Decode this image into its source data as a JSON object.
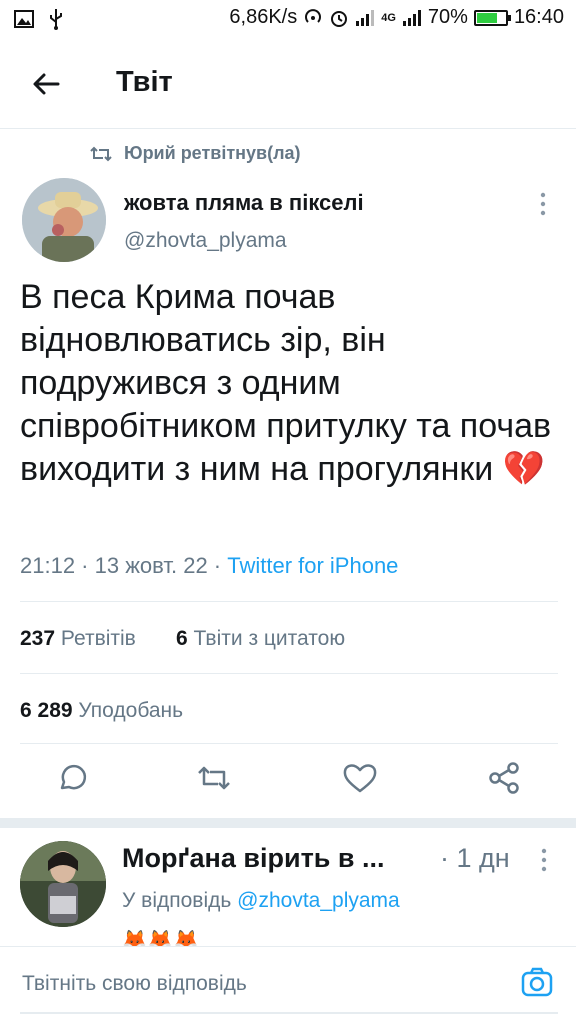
{
  "status_bar": {
    "speed": "6,86K/s",
    "net": "4G",
    "battery": "70%",
    "battery_level": 0.7,
    "time": "16:40",
    "icons": [
      "image-icon",
      "usb-icon",
      "hotspot-icon",
      "alarm-icon",
      "signal-icon",
      "signal-icon"
    ]
  },
  "header": {
    "title": "Твіт",
    "back_icon": "arrow-left-icon"
  },
  "tweet": {
    "retweeted_by": "Юрий ретвітнув(ла)",
    "author_name": "жовта пляма в пікселі",
    "author_handle": "@zhovta_plyama",
    "text": "В песа Крима почав відновлюватись зір, він подружився з одним співробітником притулку та почав виходити з ним на прогулянки 💔",
    "time": "21:12 · 13 жовт. 22 · ",
    "source": "Twitter for iPhone",
    "retweets_count": "237",
    "retweets_label": "Ретвітів",
    "quotes_count": "6",
    "quotes_label": "Твіти з цитатою",
    "likes_count": "6 289",
    "likes_label": "Уподобань"
  },
  "actions": [
    "reply-icon",
    "retweet-icon",
    "like-icon",
    "share-icon"
  ],
  "reply": {
    "author_name": "Морґана вірить в ...",
    "time": "· 1 дн",
    "replying_prefix": "У відповідь ",
    "replying_handle": "@zhovta_plyama",
    "partial_text": "🦊🦊🦊"
  },
  "composer": {
    "placeholder": "Твітніть свою відповідь",
    "camera_icon": "camera-icon"
  },
  "colors": {
    "accent": "#1da1f2",
    "muted": "#657786",
    "text": "#14171a",
    "divider": "#e6ecf0"
  }
}
